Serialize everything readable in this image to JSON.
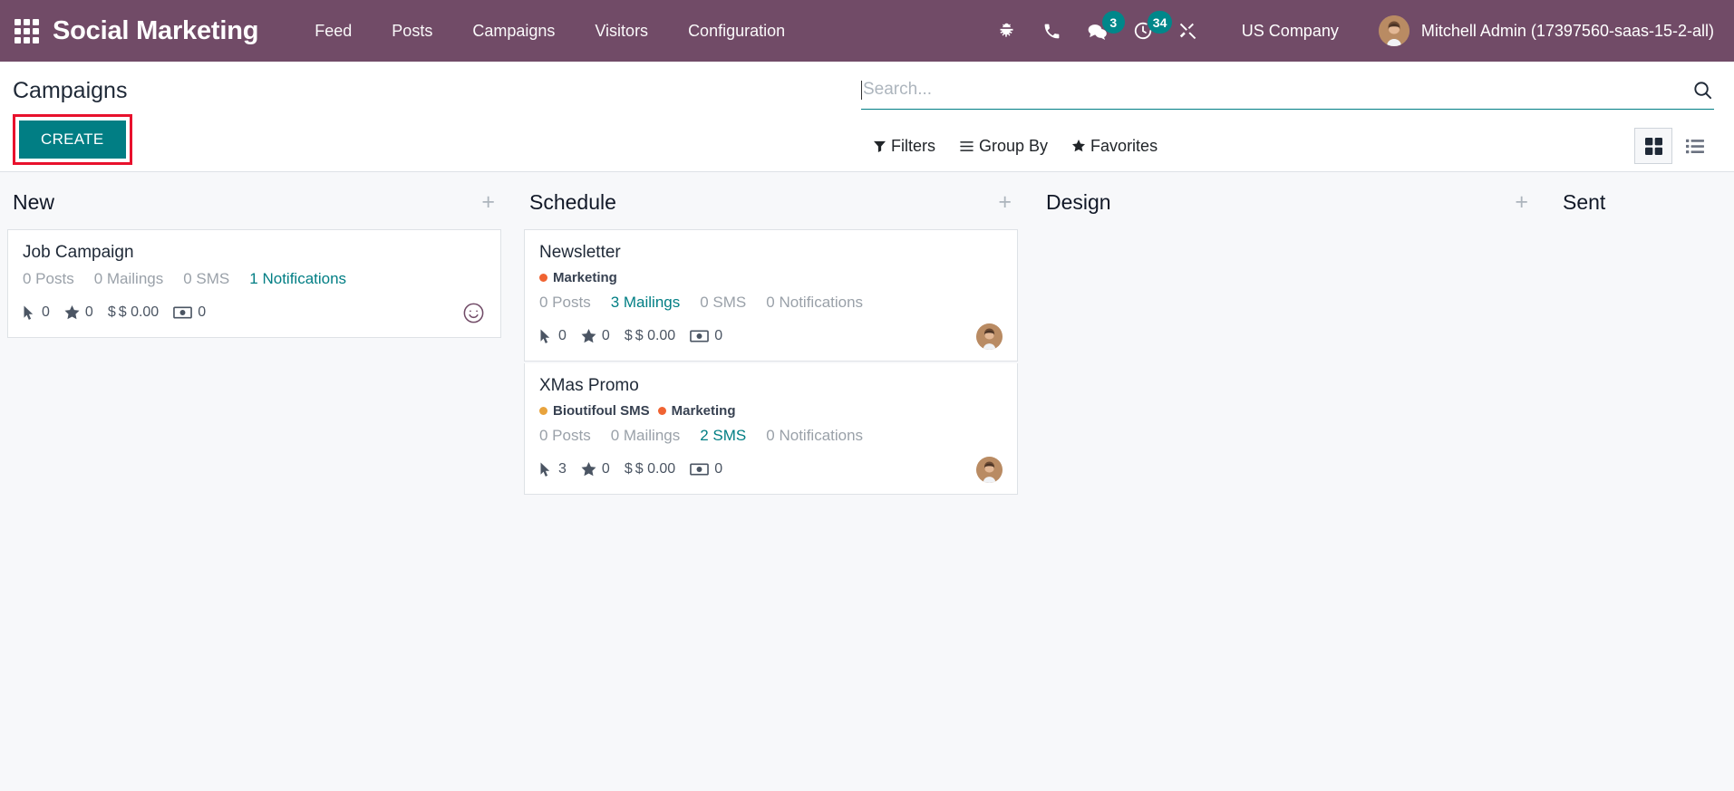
{
  "navbar": {
    "apps_icon": "apps-grid-icon",
    "brand": "Social Marketing",
    "menu_items": [
      {
        "label": "Feed"
      },
      {
        "label": "Posts"
      },
      {
        "label": "Campaigns"
      },
      {
        "label": "Visitors"
      },
      {
        "label": "Configuration"
      }
    ],
    "sys_icons": [
      {
        "name": "bug-icon",
        "badge": null
      },
      {
        "name": "phone-icon",
        "badge": null
      },
      {
        "name": "messages-icon",
        "badge": "3"
      },
      {
        "name": "activity-clock-icon",
        "badge": "34"
      },
      {
        "name": "tools-icon",
        "badge": null
      }
    ],
    "company": "US Company",
    "user_name": "Mitchell Admin (17397560-saas-15-2-all)",
    "colors": {
      "navbar_bg": "#714B67",
      "badge_bg": "#00878A",
      "text": "#FFFFFF"
    }
  },
  "control_panel": {
    "title": "Campaigns",
    "create_label": "CREATE",
    "create_highlight_color": "#E8112D",
    "create_bg": "#017E84",
    "search": {
      "placeholder": "Search...",
      "value": "",
      "icon": "search-icon"
    },
    "facets": [
      {
        "label": "Filters",
        "icon": "filter-icon"
      },
      {
        "label": "Group By",
        "icon": "bars-icon"
      },
      {
        "label": "Favorites",
        "icon": "star-icon"
      }
    ],
    "views": [
      {
        "name": "kanban-view",
        "icon": "kanban-grid-icon",
        "active": true
      },
      {
        "name": "list-view",
        "icon": "list-icon",
        "active": false
      }
    ]
  },
  "kanban": {
    "add_icon": "plus-icon",
    "columns": [
      {
        "title": "New",
        "cards": [
          {
            "title": "Job Campaign",
            "tags": [],
            "stats": [
              {
                "label": "0 Posts",
                "link": false
              },
              {
                "label": "0 Mailings",
                "link": false
              },
              {
                "label": "0 SMS",
                "link": false
              },
              {
                "label": "1 Notifications",
                "link": true
              }
            ],
            "metrics": [
              {
                "icon": "cursor-click-icon",
                "value": "0"
              },
              {
                "icon": "star-filled-icon",
                "value": "0"
              },
              {
                "icon": "dollar-icon",
                "value": "$ 0.00"
              },
              {
                "icon": "money-bill-icon",
                "value": "0"
              }
            ],
            "avatar": "smiley-placeholder"
          }
        ]
      },
      {
        "title": "Schedule",
        "cards": [
          {
            "title": "Newsletter",
            "tags": [
              {
                "label": "Marketing",
                "color": "#F06332"
              }
            ],
            "stats": [
              {
                "label": "0 Posts",
                "link": false
              },
              {
                "label": "3 Mailings",
                "link": true
              },
              {
                "label": "0 SMS",
                "link": false
              },
              {
                "label": "0 Notifications",
                "link": false
              }
            ],
            "metrics": [
              {
                "icon": "cursor-click-icon",
                "value": "0"
              },
              {
                "icon": "star-filled-icon",
                "value": "0"
              },
              {
                "icon": "dollar-icon",
                "value": "$ 0.00"
              },
              {
                "icon": "money-bill-icon",
                "value": "0"
              }
            ],
            "avatar": "user-photo"
          },
          {
            "title": "XMas Promo",
            "tags": [
              {
                "label": "Bioutifoul SMS",
                "color": "#E8A33D"
              },
              {
                "label": "Marketing",
                "color": "#F06332"
              }
            ],
            "stats": [
              {
                "label": "0 Posts",
                "link": false
              },
              {
                "label": "0 Mailings",
                "link": false
              },
              {
                "label": "2 SMS",
                "link": true
              },
              {
                "label": "0 Notifications",
                "link": false
              }
            ],
            "metrics": [
              {
                "icon": "cursor-click-icon",
                "value": "3"
              },
              {
                "icon": "star-filled-icon",
                "value": "0"
              },
              {
                "icon": "dollar-icon",
                "value": "$ 0.00"
              },
              {
                "icon": "money-bill-icon",
                "value": "0"
              }
            ],
            "avatar": "user-photo"
          }
        ]
      },
      {
        "title": "Design",
        "cards": []
      },
      {
        "title": "Sent",
        "cards": []
      }
    ]
  }
}
